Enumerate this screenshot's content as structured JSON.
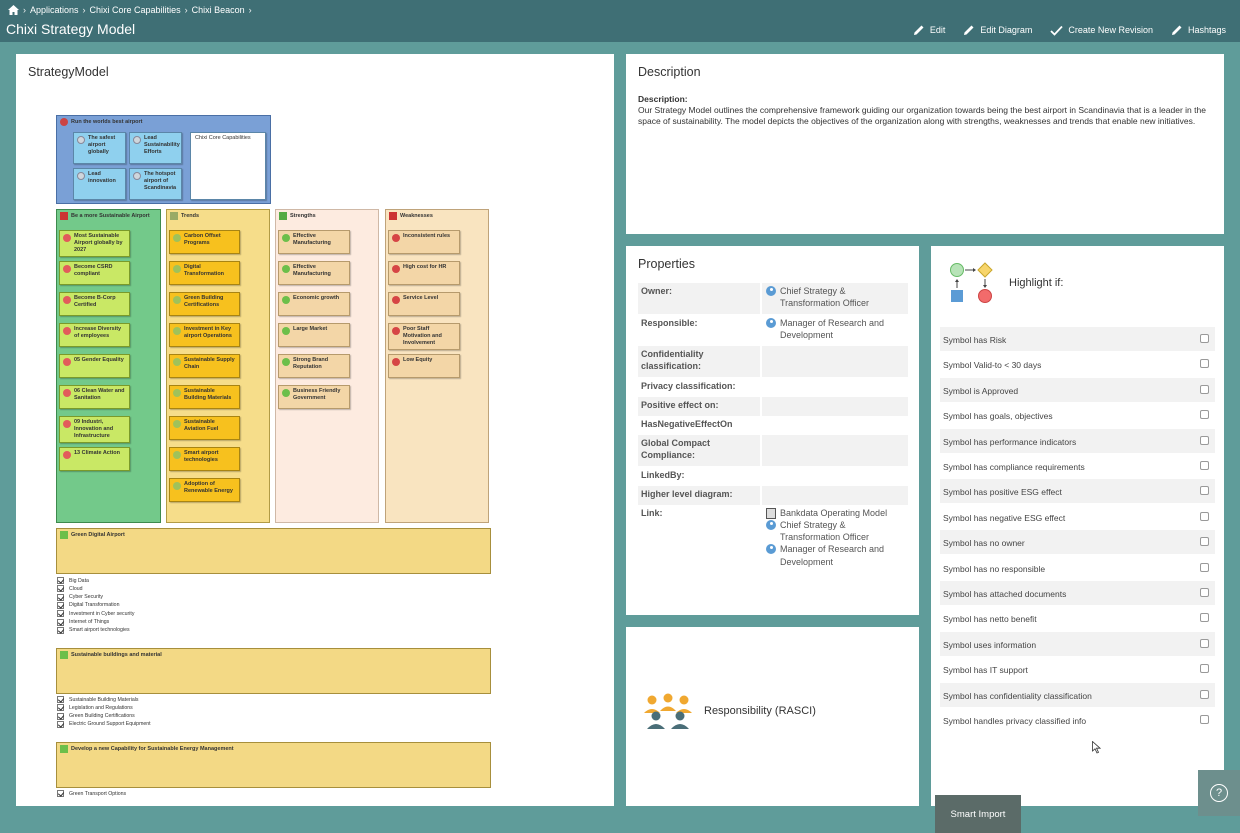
{
  "breadcrumb": [
    "Applications",
    "Chixi Core Capabilities",
    "Chixi Beacon"
  ],
  "app_title": "Chixi Strategy Model",
  "actions": [
    "Edit",
    "Edit Diagram",
    "Create New Revision",
    "Hashtags"
  ],
  "strategy_model": {
    "title": "StrategyModel",
    "goal": {
      "title": "Run the worlds best airport",
      "items": [
        "The safest airport globally",
        "Lead Sustainability Efforts",
        "Lead innovation",
        "The hotspot airport of Scandinavia"
      ],
      "side": "Chixi Core Capabilities"
    },
    "columns": [
      {
        "title": "Be a more Sustainable Airport",
        "items": [
          "Most Sustainable Airport globally by 2027",
          "Become CSRD compliant",
          "Become B-Corp Certified",
          "Increase Diversity of employees",
          "05 Gender Equality",
          "06 Clean Water and Sanitation",
          "09 Industri, Innovation and Infrastructure",
          "13 Climate Action"
        ]
      },
      {
        "title": "Trends",
        "items": [
          "Carbon Offset Programs",
          "Digital Transformation",
          "Green Building Certifications",
          "Investment in Key airport Operations",
          "Sustainable Supply Chain",
          "Sustainable Building Materials",
          "Sustainable Aviation Fuel",
          "Smart airport technologies",
          "Adoption of Renewable Energy"
        ]
      },
      {
        "title": "Strengths",
        "items": [
          "Effective Manufacturing",
          "Effective Manufacturing",
          "Economic growth",
          "Large Market",
          "Strong Brand Reputation",
          "Business Friendly Government"
        ]
      },
      {
        "title": "Weaknesses",
        "items": [
          "Inconsistent rules",
          "High cost for HR",
          "Service Level",
          "Poor Staff Motivation and Involvement",
          "Low Equity"
        ]
      }
    ],
    "sections": [
      {
        "title": "Green Digital Airport",
        "items": [
          "Big Data",
          "Cloud",
          "Cyber Security",
          "Digital Transformation",
          "Investment in Cyber security",
          "Internet of Things",
          "Smart airport technologies"
        ]
      },
      {
        "title": "Sustainable buildings and material",
        "items": [
          "Sustainable Building Materials",
          "Legislation and Regulations",
          "Green Building Certifications",
          "Electric Ground Support Equipment"
        ]
      },
      {
        "title": "Develop a new Capability for Sustainable Energy Management",
        "items": [
          "Green Transport Options"
        ]
      }
    ]
  },
  "description": {
    "title": "Description",
    "label": "Description:",
    "text": "Our Strategy Model outlines the comprehensive framework guiding our organization towards being the best airport in Scandinavia that is a leader in the space of sustainability. The model depicts the objectives of the organization along with strengths, weaknesses and trends that enable new initiatives."
  },
  "properties": {
    "title": "Properties",
    "rows": [
      {
        "key": "Owner:",
        "values": [
          "Chief Strategy & Transformation Officer"
        ]
      },
      {
        "key": "Responsible:",
        "values": [
          "Manager of Research and Development"
        ]
      },
      {
        "key": "Confidentiality classification:",
        "values": []
      },
      {
        "key": "Privacy classification:",
        "values": []
      },
      {
        "key": "Positive effect on:",
        "values": []
      },
      {
        "key": "HasNegativeEffectOn",
        "values": []
      },
      {
        "key": "Global Compact Compliance:",
        "values": []
      },
      {
        "key": "LinkedBy:",
        "values": []
      },
      {
        "key": "Higher level diagram:",
        "values": []
      },
      {
        "key": "Link:",
        "values": [
          "Bankdata Operating Model",
          "Chief Strategy & Transformation Officer",
          "Manager of Research and Development"
        ]
      }
    ]
  },
  "rasci": {
    "label": "Responsibility (RASCI)"
  },
  "highlight": {
    "title": "Highlight if:",
    "options": [
      "Symbol has Risk",
      "Symbol Valid-to < 30 days",
      "Symbol is Approved",
      "Symbol has goals, objectives",
      "Symbol has performance indicators",
      "Symbol has compliance requirements",
      "Symbol has positive ESG effect",
      "Symbol has negative ESG effect",
      "Symbol has no owner",
      "Symbol has no responsible",
      "Symbol has attached documents",
      "Symbol has netto benefit",
      "Symbol uses information",
      "Symbol has IT support",
      "Symbol has confidentiality classification",
      "Symbol handles privacy classified info"
    ]
  },
  "smart_import": "Smart Import",
  "help_icon": "?"
}
